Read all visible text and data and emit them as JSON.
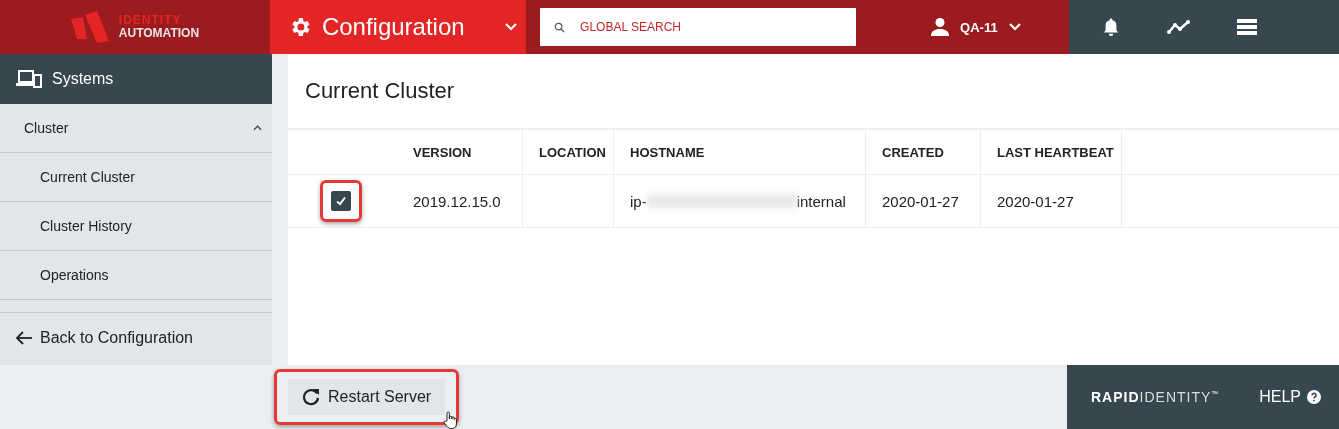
{
  "header": {
    "logo": {
      "line_1": "IDENTITY",
      "line_2": "AUTOMATION"
    },
    "section": "Configuration",
    "search": {
      "placeholder": "GLOBAL SEARCH"
    },
    "user": "QA-11"
  },
  "sidebar": {
    "title": "Systems",
    "items": [
      {
        "label": "Cluster",
        "expanded": true,
        "children": [
          {
            "label": "Current Cluster"
          },
          {
            "label": "Cluster History"
          },
          {
            "label": "Operations"
          }
        ]
      }
    ],
    "back": "Back to Configuration"
  },
  "page": {
    "title": "Current Cluster"
  },
  "table": {
    "columns": [
      "VERSION",
      "LOCATION",
      "HOSTNAME",
      "CREATED",
      "LAST HEARTBEAT"
    ],
    "rows": [
      {
        "checked": true,
        "highlighted": true,
        "cells": [
          "2019.12.15.0",
          "",
          {
            "prefix": "ip-",
            "suffix": "internal"
          },
          "2020-01-27",
          "2020-01-27"
        ]
      }
    ]
  },
  "actions": [
    {
      "label": "Restart Server",
      "highlighted": true
    }
  ],
  "footer": {
    "brand_bold": "RAPID",
    "brand_light": "IDENTITY",
    "trademark": "™",
    "help": "HELP"
  }
}
